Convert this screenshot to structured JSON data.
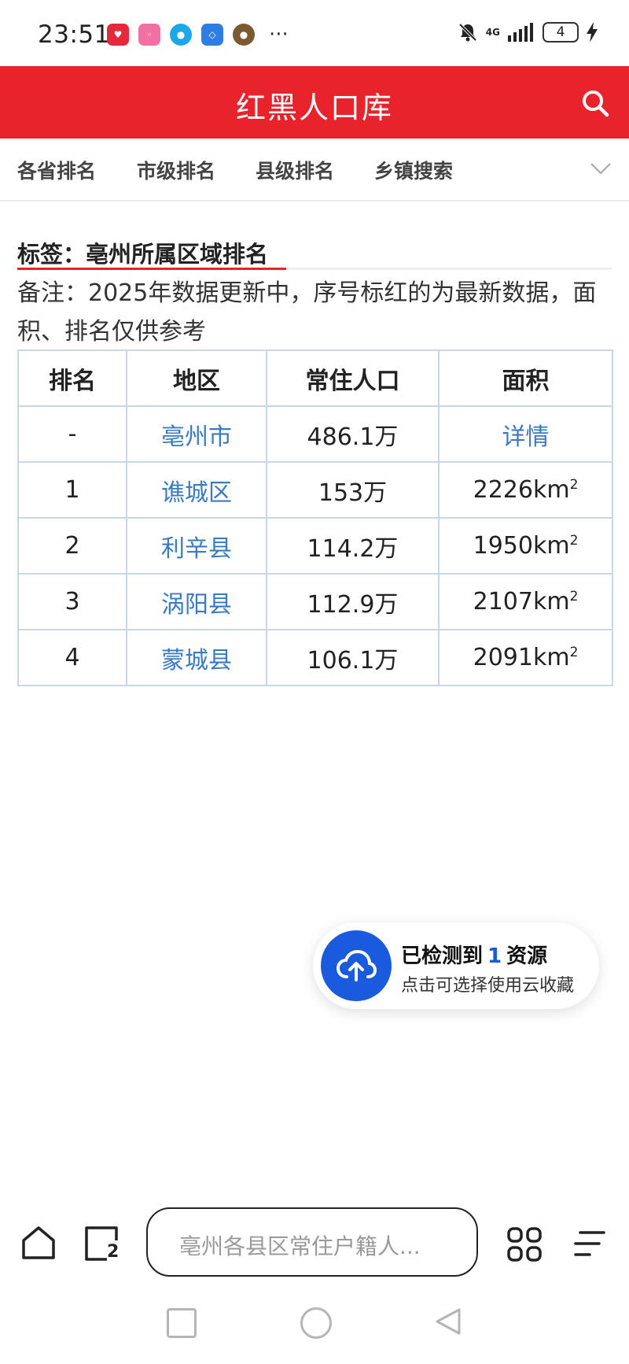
{
  "status": {
    "time": "23:51",
    "network": "4G",
    "battery": "4",
    "more": "···"
  },
  "header": {
    "title": "红黑人口库",
    "accent_color": "#e8232c"
  },
  "tabs": [
    {
      "label": "各省排名"
    },
    {
      "label": "市级排名"
    },
    {
      "label": "县级排名"
    },
    {
      "label": "乡镇搜索"
    }
  ],
  "content": {
    "tag_title": "标签：亳州所属区域排名",
    "note": "备注：2025年数据更新中，序号标红的为最新数据，面积、排名仅供参考"
  },
  "table": {
    "headers": [
      "排名",
      "地区",
      "常住人口",
      "面积"
    ],
    "rows": [
      {
        "rank": "-",
        "region": "亳州市",
        "population": "486.1万",
        "area": "详情",
        "area_sup": ""
      },
      {
        "rank": "1",
        "region": "谯城区",
        "population": "153万",
        "area": "2226km",
        "area_sup": "2"
      },
      {
        "rank": "2",
        "region": "利辛县",
        "population": "114.2万",
        "area": "1950km",
        "area_sup": "2"
      },
      {
        "rank": "3",
        "region": "涡阳县",
        "population": "112.9万",
        "area": "2107km",
        "area_sup": "2"
      },
      {
        "rank": "4",
        "region": "蒙城县",
        "population": "106.1万",
        "area": "2091km",
        "area_sup": "2"
      }
    ]
  },
  "float_card": {
    "line1_prefix": "已检测到",
    "count": "1",
    "line1_suffix": "资源",
    "line2": "点击可选择使用云收藏"
  },
  "bottom": {
    "tabs_count": "2",
    "address_text": "亳州各县区常住户籍人..."
  }
}
